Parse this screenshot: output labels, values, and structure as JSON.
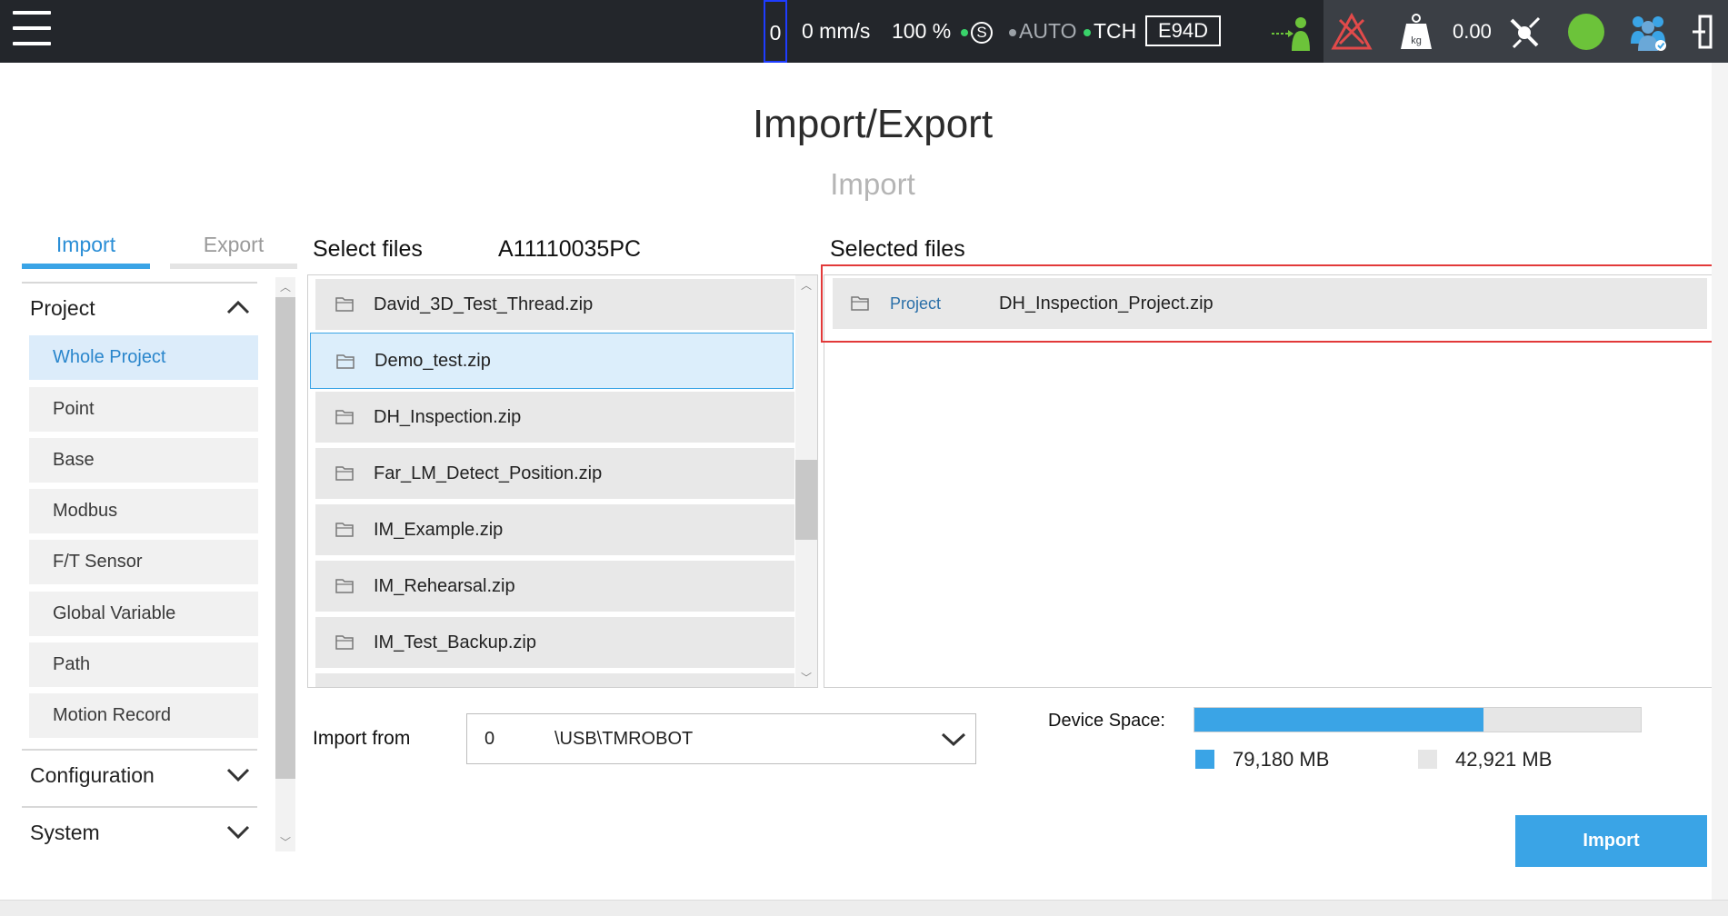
{
  "topbar": {
    "counter": "0",
    "speed": "0 mm/s",
    "percent": "100 %",
    "s_label": "S",
    "auto_label": "AUTO",
    "tch_label": "TCH",
    "device_code": "E94D",
    "payload_value": "0.00",
    "status_color": "#6cc33a"
  },
  "page": {
    "title": "Import/Export",
    "subtitle": "Import"
  },
  "tabs": {
    "import": "Import",
    "export": "Export"
  },
  "categories": {
    "project": "Project",
    "configuration": "Configuration",
    "system": "System"
  },
  "project_items": [
    "Whole Project",
    "Point",
    "Base",
    "Modbus",
    "F/T Sensor",
    "Global Variable",
    "Path",
    "Motion Record"
  ],
  "select_files": {
    "label": "Select files",
    "source_id": "A11110035PC",
    "files": [
      "David_3D_Test_Thread.zip",
      "Demo_test.zip",
      "DH_Inspection.zip",
      "Far_LM_Detect_Position.zip",
      "IM_Example.zip",
      "IM_Rehearsal.zip",
      "IM_Test_Backup.zip"
    ]
  },
  "selected_files": {
    "label": "Selected files",
    "items": [
      {
        "type": "Project",
        "name": "DH_Inspection_Project.zip"
      }
    ]
  },
  "import_from": {
    "label": "Import from",
    "value_index": "0",
    "value_path": "\\USB\\TMROBOT"
  },
  "device_space": {
    "label": "Device Space:",
    "used": "79,180 MB",
    "free": "42,921 MB",
    "used_fraction": 0.648,
    "used_color": "#3aa4e6",
    "free_color": "#e6e6e6"
  },
  "actions": {
    "import_button": "Import"
  }
}
